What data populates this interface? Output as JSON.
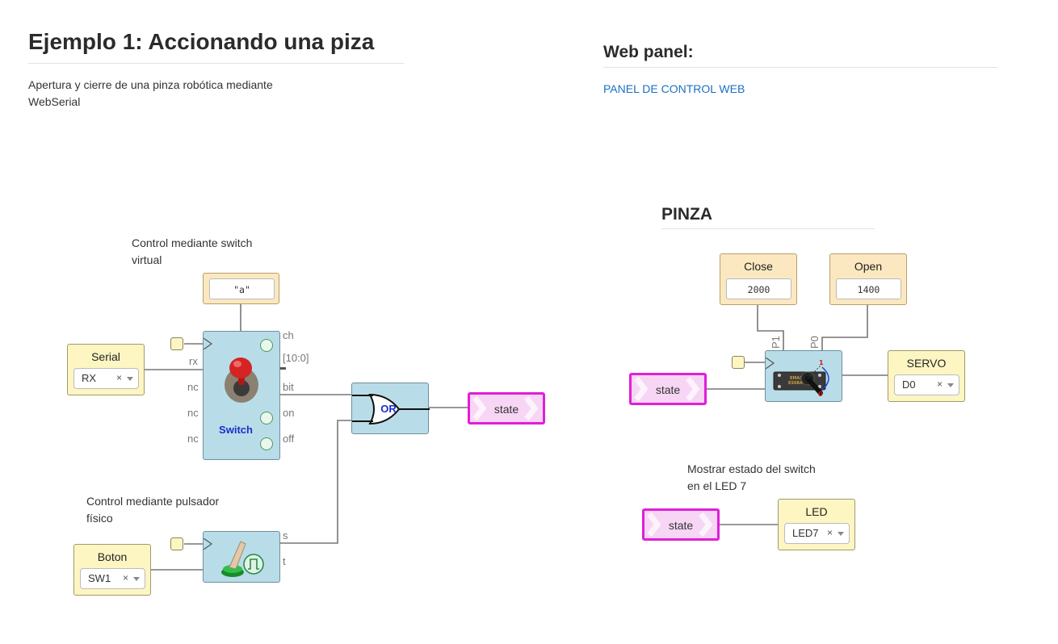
{
  "header": {
    "title": "Ejemplo 1: Accionando una piza",
    "description_line1": "Apertura y cierre de una pinza robótica mediante",
    "description_line2": "WebSerial"
  },
  "web_panel": {
    "heading": "Web panel:",
    "link": "PANEL DE CONTROL WEB"
  },
  "left_circuit": {
    "comment_switch_line1": "Control mediante switch",
    "comment_switch_line2": "virtual",
    "constant_value": "\"a\"",
    "serial": {
      "title": "Serial",
      "value": "RX",
      "clear": "×"
    },
    "switch_module": {
      "label": "Switch",
      "pins_in": [
        "rx",
        "nc",
        "nc",
        "nc"
      ],
      "pins_out": [
        "ch",
        "[10:0]",
        "bit",
        "on",
        "off"
      ]
    },
    "or_gate_label": "OR",
    "state_tag": "state",
    "comment_button_line1": "Control mediante pulsador",
    "comment_button_line2": "físico",
    "boton": {
      "title": "Boton",
      "value": "SW1",
      "clear": "×"
    },
    "button_module": {
      "pins_out": [
        "s",
        "t"
      ]
    }
  },
  "pinza": {
    "heading": "PINZA",
    "close": {
      "title": "Close",
      "value": "2000"
    },
    "open": {
      "title": "Open",
      "value": "1400"
    },
    "servo_pins": [
      "P1",
      "P0"
    ],
    "servo_marks": [
      "1",
      "0"
    ],
    "servo_chip": "EMAX ES08A",
    "state_tag": "state",
    "servo_out": {
      "title": "SERVO",
      "value": "D0",
      "clear": "×"
    },
    "comment_led_line1": "Mostrar estado del switch",
    "comment_led_line2": "en el LED 7",
    "led_state_tag": "state",
    "led": {
      "title": "LED",
      "value": "LED7",
      "clear": "×"
    }
  },
  "colors": {
    "tag_border": "#e01fd8",
    "module_fill": "#b9dde8",
    "input_fill": "#fdf6c3",
    "link": "#1a6fc4"
  }
}
